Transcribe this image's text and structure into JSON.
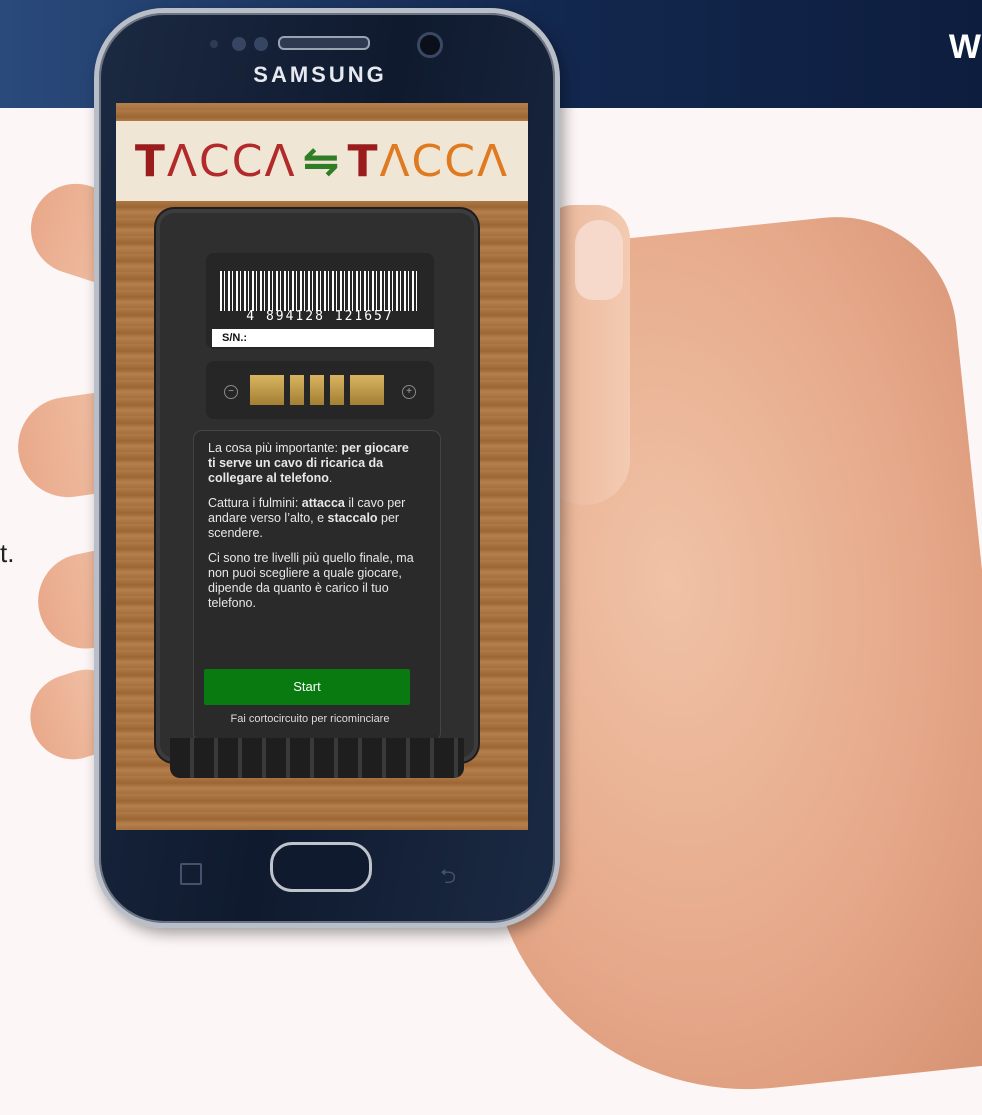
{
  "background": {
    "header_text": "W",
    "side_text": "t."
  },
  "phone": {
    "brand": "SAMSUNG"
  },
  "game": {
    "logo": {
      "t1": "T",
      "rest1": "ΛCCΛ",
      "plug": "⇋",
      "t2": "T",
      "rest2": "ΛCCΛ"
    },
    "battery": {
      "barcode_number": "4 894128 121657",
      "sn_label": "S/N.:",
      "minus": "−",
      "plus": "+"
    },
    "info": {
      "p1_a": "La cosa più importante: ",
      "p1_b": "per giocare ti serve un cavo di ricarica da collegare al telefono",
      "p1_c": ".",
      "p2_a": "Cattura i fulmini: ",
      "p2_b": "attacca",
      "p2_c": " il cavo per andare verso l’alto, e ",
      "p2_d": "staccalo",
      "p2_e": " per scendere.",
      "p3": "Ci sono tre livelli più quello finale, ma non puoi scegliere a quale giocare, dipende da quanto è carico il tuo telefono."
    },
    "start_label": "Start",
    "reset_note": "Fai cortocircuito per ricominciare"
  }
}
